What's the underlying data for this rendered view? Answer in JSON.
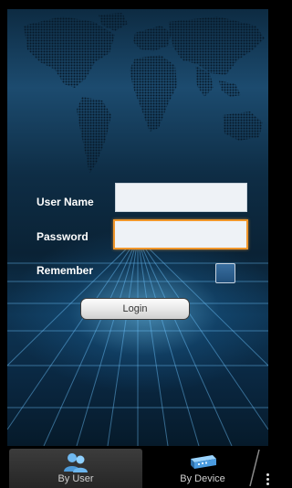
{
  "login_form": {
    "username_label": "User Name",
    "username_value": "",
    "password_label": "Password",
    "password_value": "",
    "remember_label": "Remember",
    "remember_checked": false,
    "login_button": "Login"
  },
  "tabbar": {
    "tabs": [
      {
        "label": "By User",
        "icon": "users-icon",
        "active": true
      },
      {
        "label": "By Device",
        "icon": "device-icon",
        "active": false
      }
    ],
    "overflow_icon": "overflow-menu-icon"
  },
  "colors": {
    "focus_border": "#f0962a",
    "screen_background": "#0d2b42",
    "tab_active": "#3c3c3c"
  }
}
